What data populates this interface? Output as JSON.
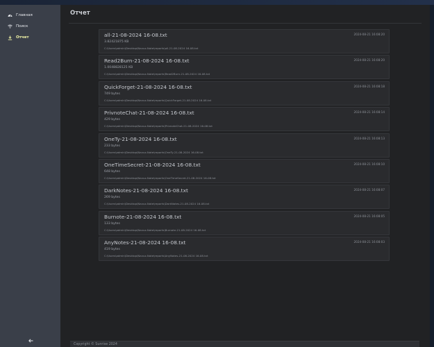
{
  "sidebar": {
    "items": [
      {
        "label": "Главная",
        "icon": "dashboard-icon"
      },
      {
        "label": "Поиск",
        "icon": "wifi-icon"
      },
      {
        "label": "Отчет",
        "icon": "download-icon"
      }
    ],
    "back_icon": "arrow-left-icon"
  },
  "main": {
    "title": "Отчет",
    "files": [
      {
        "name": "all-21-08-2024 16-08.txt",
        "size": "3.82421875 KB",
        "path": "C:\\Users\\admin\\Desktop\\Navuz-Note\\reports\\all-21-08-2024 16-08.txt",
        "date": "2024-08-21 16:08:20"
      },
      {
        "name": "Read2Burn-21-08-2024 16-08.txt",
        "size": "1.0048828125 KB",
        "path": "C:\\Users\\admin\\Desktop\\Navuz-Note\\reports\\Read2Burn-21-08-2024 16-08.txt",
        "date": "2024-08-21 16:08:20"
      },
      {
        "name": "QuickForget-21-08-2024 16-08.txt",
        "size": "749 bytes",
        "path": "C:\\Users\\admin\\Desktop\\Navuz-Note\\reports\\QuickForget-21-08-2024 16-08.txt",
        "date": "2024-08-21 16:08:18"
      },
      {
        "name": "PrivnoteChat-21-08-2024 16-08.txt",
        "size": "429 bytes",
        "path": "C:\\Users\\admin\\Desktop\\Navuz-Note\\reports\\PrivnoteChat-21-08-2024 16-08.txt",
        "date": "2024-08-21 16:08:14"
      },
      {
        "name": "OneTy-21-08-2024 16-08.txt",
        "size": "233 bytes",
        "path": "C:\\Users\\admin\\Desktop\\Navuz-Note\\reports\\OneTy-21-08-2024 16-08.txt",
        "date": "2024-08-21 16:08:13"
      },
      {
        "name": "OneTimeSecret-21-08-2024 16-08.txt",
        "size": "648 bytes",
        "path": "C:\\Users\\admin\\Desktop\\Navuz-Note\\reports\\OneTimeSecret-21-08-2024 16-08.txt",
        "date": "2024-08-21 16:08:10"
      },
      {
        "name": "DarkNotes-21-08-2024 16-08.txt",
        "size": "269 bytes",
        "path": "C:\\Users\\admin\\Desktop\\Navuz-Note\\reports\\DarkNotes-21-08-2024 16-08.txt",
        "date": "2024-08-21 16:08:07"
      },
      {
        "name": "Burnote-21-08-2024 16-08.txt",
        "size": "133 bytes",
        "path": "C:\\Users\\admin\\Desktop\\Navuz-Note\\reports\\Burnote-21-08-2024 16-08.txt",
        "date": "2024-08-21 16:08:05"
      },
      {
        "name": "AnyNotes-21-08-2024 16-08.txt",
        "size": "419 bytes",
        "path": "C:\\Users\\admin\\Desktop\\Navuz-Note\\reports\\AnyNotes-21-08-2024 16-08.txt",
        "date": "2024-08-21 16:08:03"
      }
    ]
  },
  "footer": {
    "text": "Copyright © Sunrise 2024"
  },
  "colors": {
    "sidebar": "#3a3f49",
    "main": "#212224",
    "active_nav": "#f0f3a6",
    "card": "#2a2b2e"
  }
}
